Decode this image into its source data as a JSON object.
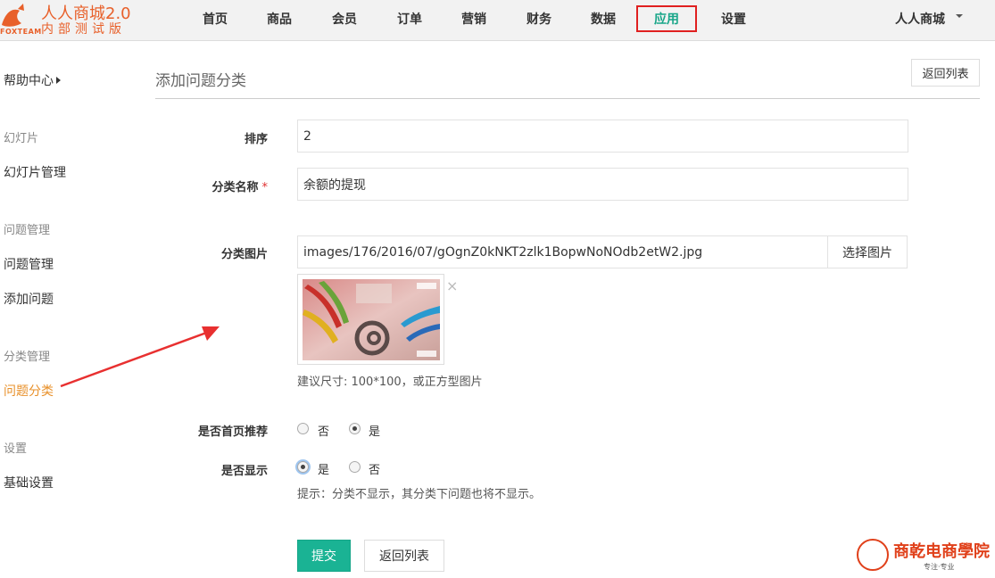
{
  "brand": {
    "title": "人人商城2.0",
    "tagline": "内部测试版",
    "sub": "FOXTEAM",
    "color": "#e8602a"
  },
  "nav": {
    "items": [
      {
        "label": "首页"
      },
      {
        "label": "商品"
      },
      {
        "label": "会员"
      },
      {
        "label": "订单"
      },
      {
        "label": "营销"
      },
      {
        "label": "财务"
      },
      {
        "label": "数据"
      },
      {
        "label": "应用",
        "active": true
      },
      {
        "label": "设置"
      }
    ],
    "user_label": "人人商城"
  },
  "sidebar": {
    "help_label": "帮助中心",
    "groups": [
      {
        "title": "幻灯片",
        "links": [
          {
            "label": "幻灯片管理"
          }
        ]
      },
      {
        "title": "问题管理",
        "links": [
          {
            "label": "问题管理"
          },
          {
            "label": "添加问题"
          }
        ]
      },
      {
        "title": "分类管理",
        "links": [
          {
            "label": "问题分类",
            "active": true
          }
        ]
      },
      {
        "title": "设置",
        "links": [
          {
            "label": "基础设置"
          }
        ]
      }
    ]
  },
  "page": {
    "title": "添加问题分类",
    "back_top_label": "返回列表"
  },
  "form": {
    "order_label": "排序",
    "order_value": "2",
    "name_label": "分类名称",
    "required_mark": "*",
    "name_value": "余额的提现",
    "image_label": "分类图片",
    "image_value": "images/176/2016/07/gOgnZ0kNKT2zlk1BopwNoNOdb2etW2.jpg",
    "pick_image_label": "选择图片",
    "remove_icon": "×",
    "image_hint": "建议尺寸: 100*100，或正方型图片",
    "recommend_label": "是否首页推荐",
    "recommend_options": [
      {
        "label": "否",
        "checked": false
      },
      {
        "label": "是",
        "checked": true
      }
    ],
    "display_label": "是否显示",
    "display_options": [
      {
        "label": "是",
        "checked": true
      },
      {
        "label": "否",
        "checked": false
      }
    ],
    "display_hint": "提示：分类不显示，其分类下问题也将不显示。",
    "submit_label": "提交",
    "back_label": "返回列表"
  },
  "colors": {
    "primary": "#1ab394",
    "active_nav": "#18a689",
    "active_side": "#e8902a",
    "annotation": "#e83030"
  },
  "watermark": {
    "title": "商乾电商學院",
    "slogan": "专注·专业"
  }
}
